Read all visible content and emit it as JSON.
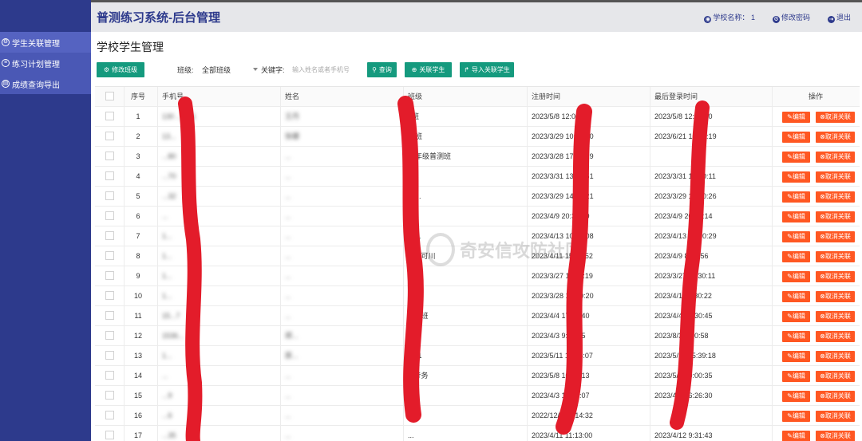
{
  "header": {
    "title": "普测练习系统-后台管理",
    "school_label": "学校名称：",
    "school_value": "1",
    "change_password": "修改密码",
    "logout": "退出"
  },
  "sidebar": {
    "items": [
      {
        "label": "学生关联管理",
        "icon": "circle-gear-icon"
      },
      {
        "label": "练习计划管理",
        "icon": "list-icon"
      },
      {
        "label": "成绩查询导出",
        "icon": "chart-icon"
      }
    ]
  },
  "page": {
    "title": "学校学生管理",
    "edit_class_button": "修改班级",
    "class_label": "班级:",
    "class_value": "全部班级",
    "keyword_label": "关键字:",
    "keyword_placeholder": "输入姓名或者手机号",
    "search_button": "查询",
    "link_student_button": "关联学生",
    "import_button": "导入关联学生"
  },
  "table": {
    "headers": {
      "seq": "序号",
      "phone": "手机号",
      "name": "姓名",
      "class": "班级",
      "reg_time": "注册时间",
      "last_login": "最后登录时间",
      "ops": "操作"
    },
    "edit_label": "编辑",
    "unlink_label": "取消关联",
    "rows": [
      {
        "seq": "1",
        "phone": "130 ... 131",
        "name": "王丹",
        "class": "1班",
        "reg": "2023/5/8 12:00:36",
        "login": "2023/5/8 12:00:40"
      },
      {
        "seq": "2",
        "phone": "13...",
        "name": "张娜",
        "class": "二班",
        "reg": "2023/3/29 10:20:10",
        "login": "2023/6/21 10:20:19"
      },
      {
        "seq": "3",
        "phone": "...80",
        "name": "...",
        "class": "一年级普测班",
        "reg": "2023/3/28 17:30:29",
        "login": ""
      },
      {
        "seq": "4",
        "phone": "...70",
        "name": "...",
        "class": "1",
        "reg": "2023/3/31 13:30:51",
        "login": "2023/3/31 13:30:11"
      },
      {
        "seq": "5",
        "phone": "...32",
        "name": "...",
        "class": "新...",
        "reg": "2023/3/29 14:30:21",
        "login": "2023/3/29 14:30:26"
      },
      {
        "seq": "6",
        "phone": "...",
        "name": "...",
        "class": "...",
        "reg": "2023/4/9 20:30:10",
        "login": "2023/4/9 20:30:14"
      },
      {
        "seq": "7",
        "phone": "1...",
        "name": "...",
        "class": "计...",
        "reg": "2023/4/13 10:30:08",
        "login": "2023/4/13 10:30:29"
      },
      {
        "seq": "8",
        "phone": "1...",
        "name": "...",
        "class": "计...可川",
        "reg": "2023/4/11 15:30:52",
        "login": "2023/4/9 8:30:56"
      },
      {
        "seq": "9",
        "phone": "1...",
        "name": "...",
        "class": "2...1",
        "reg": "2023/3/27 11:30:19",
        "login": "2023/3/27 11:30:11"
      },
      {
        "seq": "10",
        "phone": "1...",
        "name": "...",
        "class": "...",
        "reg": "2023/3/28 16:30:20",
        "login": "2023/4/11 8:30:22"
      },
      {
        "seq": "11",
        "phone": "15...7",
        "name": "...",
        "class": "...普班",
        "reg": "2023/4/4 17:30:40",
        "login": "2023/4/4 17:30:45"
      },
      {
        "seq": "12",
        "phone": "1536...",
        "name": "郑...",
        "class": "...班",
        "reg": "2023/4/3 9:30:55",
        "login": "2023/8/3 9:30:58"
      },
      {
        "seq": "13",
        "phone": "1...",
        "name": "原...",
        "class": "...01",
        "reg": "2023/5/11 15:05:07",
        "login": "2023/5/11 15:39:18"
      },
      {
        "seq": "14",
        "phone": "...",
        "name": "...",
        "class": "...考务",
        "reg": "2023/5/8 10:00:13",
        "login": "2023/5/8 10:00:35"
      },
      {
        "seq": "15",
        "phone": "...9",
        "name": "...",
        "class": "...1",
        "reg": "2023/4/3 16:26:07",
        "login": "2023/4/3 16:26:30"
      },
      {
        "seq": "16",
        "phone": "...6",
        "name": "...",
        "class": "...",
        "reg": "2022/12/1 11:14:32",
        "login": ""
      },
      {
        "seq": "17",
        "phone": "...35",
        "name": "...",
        "class": "...",
        "reg": "2023/4/11 11:13:00",
        "login": "2023/4/12 9:31:43"
      }
    ]
  },
  "watermark": "奇安信攻防社区",
  "colors": {
    "sidebar": "#2d3a8c",
    "accent_green": "#159a7e",
    "danger_orange": "#ff5722",
    "scribble_red": "#e31c2a"
  }
}
